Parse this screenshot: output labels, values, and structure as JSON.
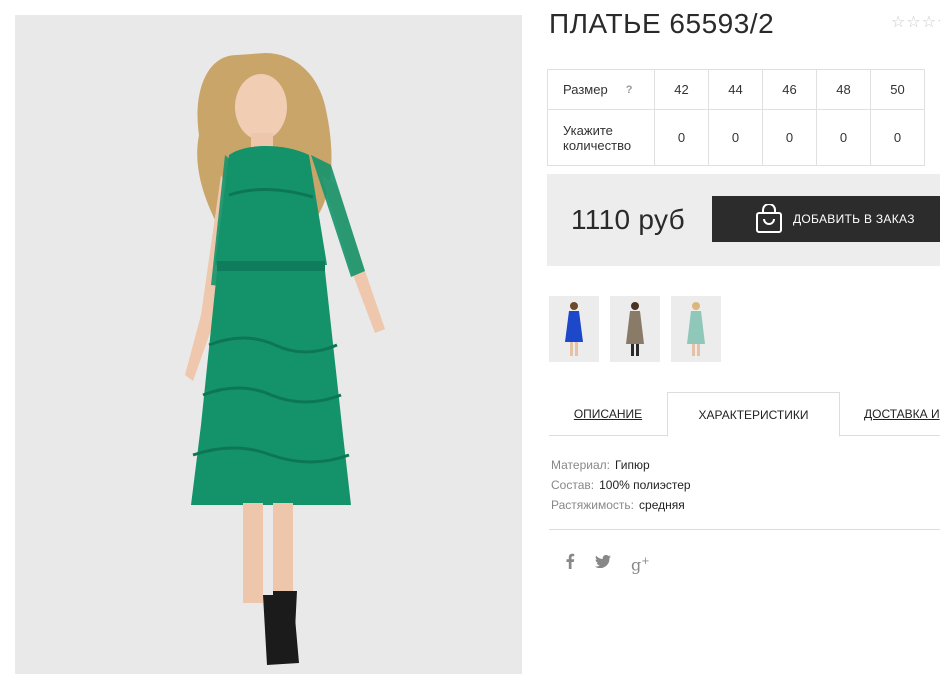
{
  "product": {
    "title": "ПЛАТЬЕ 65593/2",
    "rating": {
      "stars_total": 5,
      "stars_filled": 0
    }
  },
  "sizes": {
    "size_label": "Размер",
    "help": "?",
    "qty_label_line1": "Укажите",
    "qty_label_line2": "количество",
    "values": [
      "42",
      "44",
      "46",
      "48",
      "50"
    ],
    "quantities": [
      "0",
      "0",
      "0",
      "0",
      "0"
    ]
  },
  "price": {
    "amount": "1110 руб",
    "order_button": "ДОБАВИТЬ В ЗАКАЗ"
  },
  "thumbnails": [
    {
      "name": "blue-dress",
      "color": "#1c48c9"
    },
    {
      "name": "beige-dress",
      "color": "#8a7a68"
    },
    {
      "name": "mint-dress",
      "color": "#8fc7b8"
    }
  ],
  "tabs": [
    {
      "label": "ОПИСАНИЕ",
      "active": false
    },
    {
      "label": "ХАРАКТЕРИСТИКИ",
      "active": true
    },
    {
      "label": "ДОСТАВКА И",
      "active": false
    }
  ],
  "specs": [
    {
      "key": "Материал:",
      "value": "Гипюр"
    },
    {
      "key": "Состав:",
      "value": "100% полиэстер"
    },
    {
      "key": "Растяжимость:",
      "value": "средняя"
    }
  ],
  "social": [
    {
      "icon": "facebook-icon",
      "glyph": "f"
    },
    {
      "icon": "twitter-icon",
      "glyph": "t"
    },
    {
      "icon": "google-plus-icon",
      "glyph": "g+"
    }
  ],
  "colors": {
    "dress": "#14936b",
    "button": "#2c2c2c",
    "price_bg": "#ededed"
  }
}
